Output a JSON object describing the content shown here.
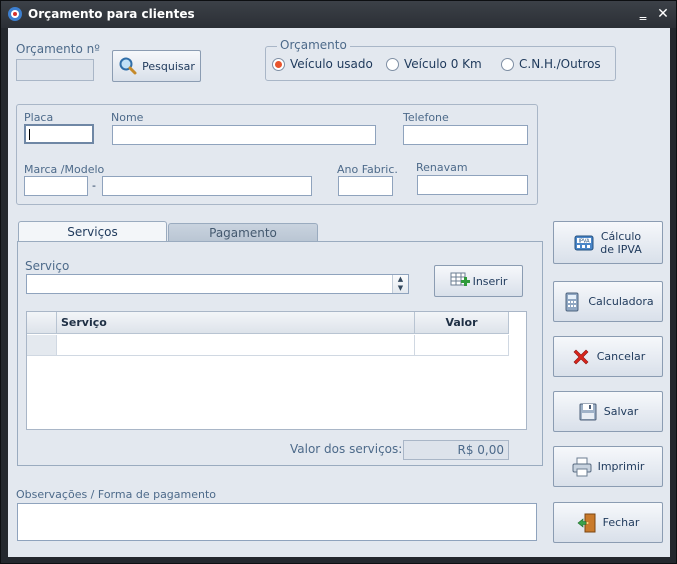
{
  "window": {
    "title": "Orçamento para clientes",
    "min_glyph": "‗",
    "close_glyph": "✕"
  },
  "header": {
    "orcamento_label": "Orçamento nº",
    "orcamento_value": "",
    "search_label": "Pesquisar"
  },
  "type_group": {
    "title": "Orçamento",
    "options": [
      {
        "label": "Veículo usado",
        "selected": true
      },
      {
        "label": "Veículo 0 Km",
        "selected": false
      },
      {
        "label": "C.N.H./Outros",
        "selected": false
      }
    ]
  },
  "vehicle": {
    "placa_label": "Placa",
    "nome_label": "Nome",
    "telefone_label": "Telefone",
    "marca_label": "Marca /Modelo",
    "marca_sep": "-",
    "ano_label": "Ano Fabric.",
    "renavam_label": "Renavam"
  },
  "tabs": [
    {
      "label": "Serviços",
      "active": true
    },
    {
      "label": "Pagamento",
      "active": false
    }
  ],
  "services": {
    "servico_label": "Serviço",
    "insert_label": "Inserir",
    "columns": [
      "Serviço",
      "Valor"
    ],
    "total_label": "Valor dos serviços:",
    "total_value": "R$ 0,00"
  },
  "observacoes_label": "Observações / Forma de pagamento",
  "side_buttons": {
    "ipva_line1": "Cálculo",
    "ipva_line2": "de IPVA",
    "calc": "Calculadora",
    "cancel": "Cancelar",
    "save": "Salvar",
    "print": "Imprimir",
    "close": "Fechar"
  },
  "icons": {
    "app": "app-icon",
    "search": "magnifier-icon",
    "insert": "grid-plus-icon",
    "ipva": "ipva-icon",
    "calc": "calculator-icon",
    "cancel": "red-x-icon",
    "save": "floppy-icon",
    "print": "printer-icon",
    "close": "door-exit-icon"
  },
  "colors": {
    "accent": "#e8542c",
    "frame": "#24282e",
    "client": "#e3e8ef"
  }
}
